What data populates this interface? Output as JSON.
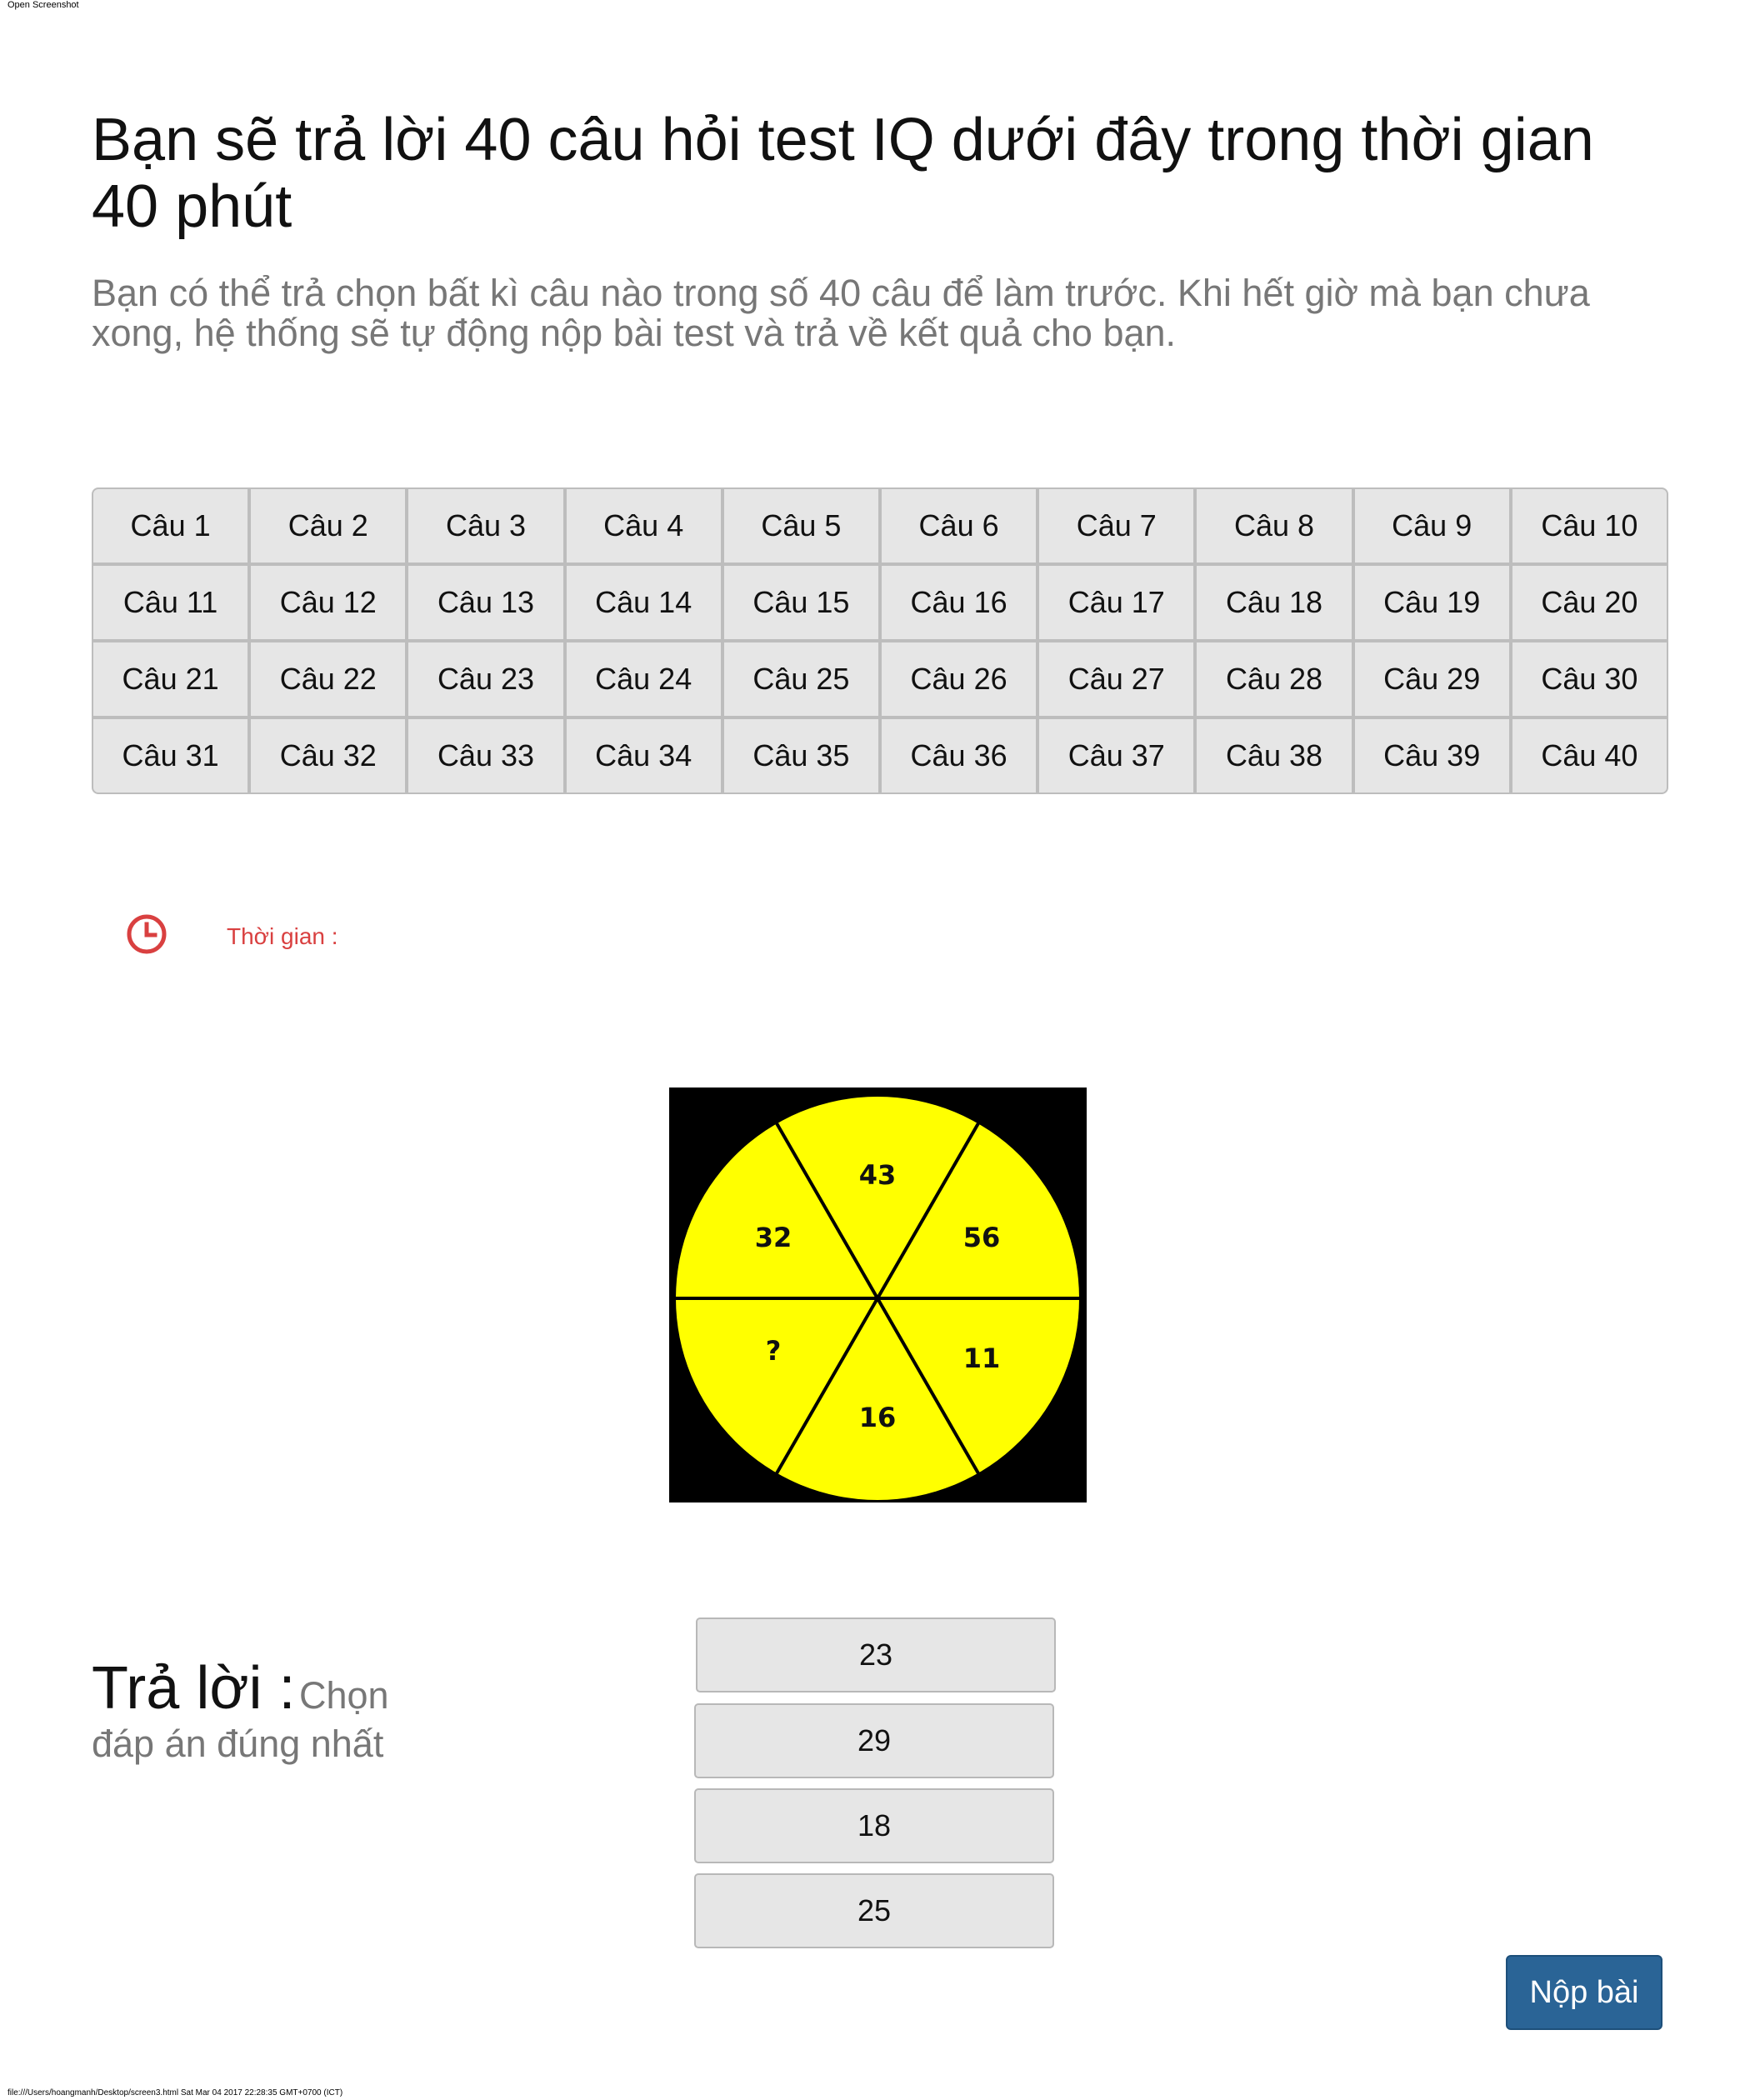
{
  "print_header": "Open Screenshot",
  "print_footer": "file:///Users/hoangmanh/Desktop/screen3.html Sat Mar 04 2017 22:28:35 GMT+0700 (ICT)",
  "title": "Bạn sẽ trả lời 40 câu hỏi test IQ dưới đây trong thời gian 40 phút",
  "subtitle": "Bạn có thể trả chọn bất kì câu nào trong số 40 câu để làm trước. Khi hết giờ mà bạn chưa xong, hệ thống sẽ tự động nộp bài test và trả về kết quả cho bạn.",
  "questions": [
    "Câu 1",
    "Câu 2",
    "Câu 3",
    "Câu 4",
    "Câu 5",
    "Câu 6",
    "Câu 7",
    "Câu 8",
    "Câu 9",
    "Câu 10",
    "Câu 11",
    "Câu 12",
    "Câu 13",
    "Câu 14",
    "Câu 15",
    "Câu 16",
    "Câu 17",
    "Câu 18",
    "Câu 19",
    "Câu 20",
    "Câu 21",
    "Câu 22",
    "Câu 23",
    "Câu 24",
    "Câu 25",
    "Câu 26",
    "Câu 27",
    "Câu 28",
    "Câu 29",
    "Câu 30",
    "Câu 31",
    "Câu 32",
    "Câu 33",
    "Câu 34",
    "Câu 35",
    "Câu 36",
    "Câu 37",
    "Câu 38",
    "Câu 39",
    "Câu 40"
  ],
  "timer": {
    "label": "Thời gian :",
    "icon": "clock-icon",
    "color": "#d94040"
  },
  "puzzle": {
    "segments": [
      "43",
      "56",
      "11",
      "16",
      "?",
      "32"
    ],
    "fill_color": "#ffff00",
    "background_color": "#000000"
  },
  "answer": {
    "title": "Trả lời :",
    "hint": "Chọn đáp án đúng nhất"
  },
  "options": [
    "23",
    "29",
    "18",
    "25"
  ],
  "submit_label": "Nộp bài",
  "colors": {
    "submit_bg": "#2a6496",
    "button_bg": "#e6e6e6",
    "muted_text": "#777777"
  }
}
